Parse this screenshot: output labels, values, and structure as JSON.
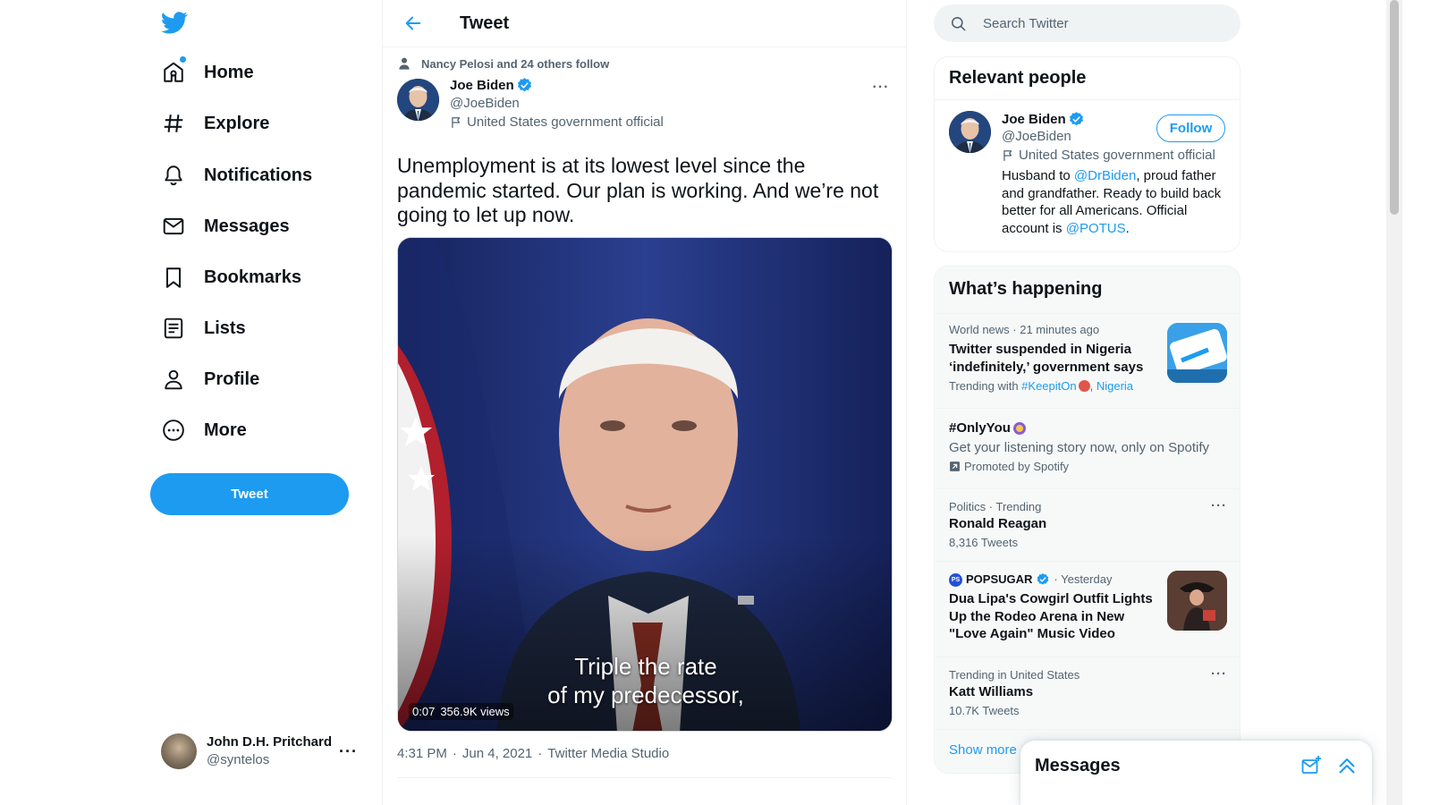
{
  "nav": {
    "items": [
      {
        "label": "Home",
        "icon": "home-icon"
      },
      {
        "label": "Explore",
        "icon": "hashtag-icon"
      },
      {
        "label": "Notifications",
        "icon": "bell-icon"
      },
      {
        "label": "Messages",
        "icon": "envelope-icon"
      },
      {
        "label": "Bookmarks",
        "icon": "bookmark-icon"
      },
      {
        "label": "Lists",
        "icon": "list-icon"
      },
      {
        "label": "Profile",
        "icon": "person-icon"
      },
      {
        "label": "More",
        "icon": "more-circle-icon"
      }
    ],
    "tweet_button": "Tweet"
  },
  "account": {
    "name": "John D.H. Pritchard",
    "handle": "@syntelos",
    "more": "···"
  },
  "main": {
    "header_title": "Tweet",
    "social_context": "Nancy Pelosi and 24 others follow",
    "author": {
      "name": "Joe Biden",
      "handle": "@JoeBiden",
      "label": "United States government official"
    },
    "more": "···",
    "text": "Unemployment is at its lowest level since the pandemic started. Our plan is working. And we’re not going to let up now.",
    "media": {
      "subtitle_line1": "Triple the rate",
      "subtitle_line2": "of my predecessor,",
      "duration": "0:07",
      "views": "356.9K views"
    },
    "meta": {
      "time": "4:31 PM",
      "date": "Jun 4, 2021",
      "source": "Twitter Media Studio",
      "separator": "·"
    }
  },
  "search": {
    "placeholder": "Search Twitter"
  },
  "relevant": {
    "title": "Relevant people",
    "person": {
      "name": "Joe Biden",
      "handle": "@JoeBiden",
      "label": "United States government official",
      "bio_pre": "Husband to ",
      "bio_mention1": "@DrBiden",
      "bio_mid": ", proud father and grandfather. Ready to build back better for all Americans. Official account is ",
      "bio_mention2": "@POTUS",
      "bio_post": ".",
      "follow_label": "Follow"
    }
  },
  "trends": {
    "title": "What’s happening",
    "items": [
      {
        "meta": "World news · 21 minutes ago",
        "title": "Twitter suspended in Nigeria ‘indefinitely,’ government says",
        "sub_pre": "Trending with ",
        "sub_tag1": "#KeepitOn",
        "sub_sep": ", ",
        "sub_tag2": "Nigeria"
      },
      {
        "title": "#OnlyYou",
        "desc": "Get your listening story now, only on Spotify",
        "promoted": "Promoted by Spotify"
      },
      {
        "meta": "Politics · Trending",
        "title": "Ronald Reagan",
        "sub": "8,316 Tweets",
        "more": "···"
      },
      {
        "source": "POPSUGAR",
        "time": "· Yesterday",
        "title": "Dua Lipa's Cowgirl Outfit Lights Up the Rodeo Arena in New \"Love Again\" Music Video"
      },
      {
        "meta": "Trending in United States",
        "title": "Katt Williams",
        "sub": "10.7K Tweets",
        "more": "···"
      }
    ],
    "show_more": "Show more"
  },
  "messages_drawer": {
    "title": "Messages"
  },
  "colors": {
    "accent": "#1d9bf0",
    "text": "#0f1419",
    "muted": "#536471",
    "border": "#eff3f4"
  }
}
